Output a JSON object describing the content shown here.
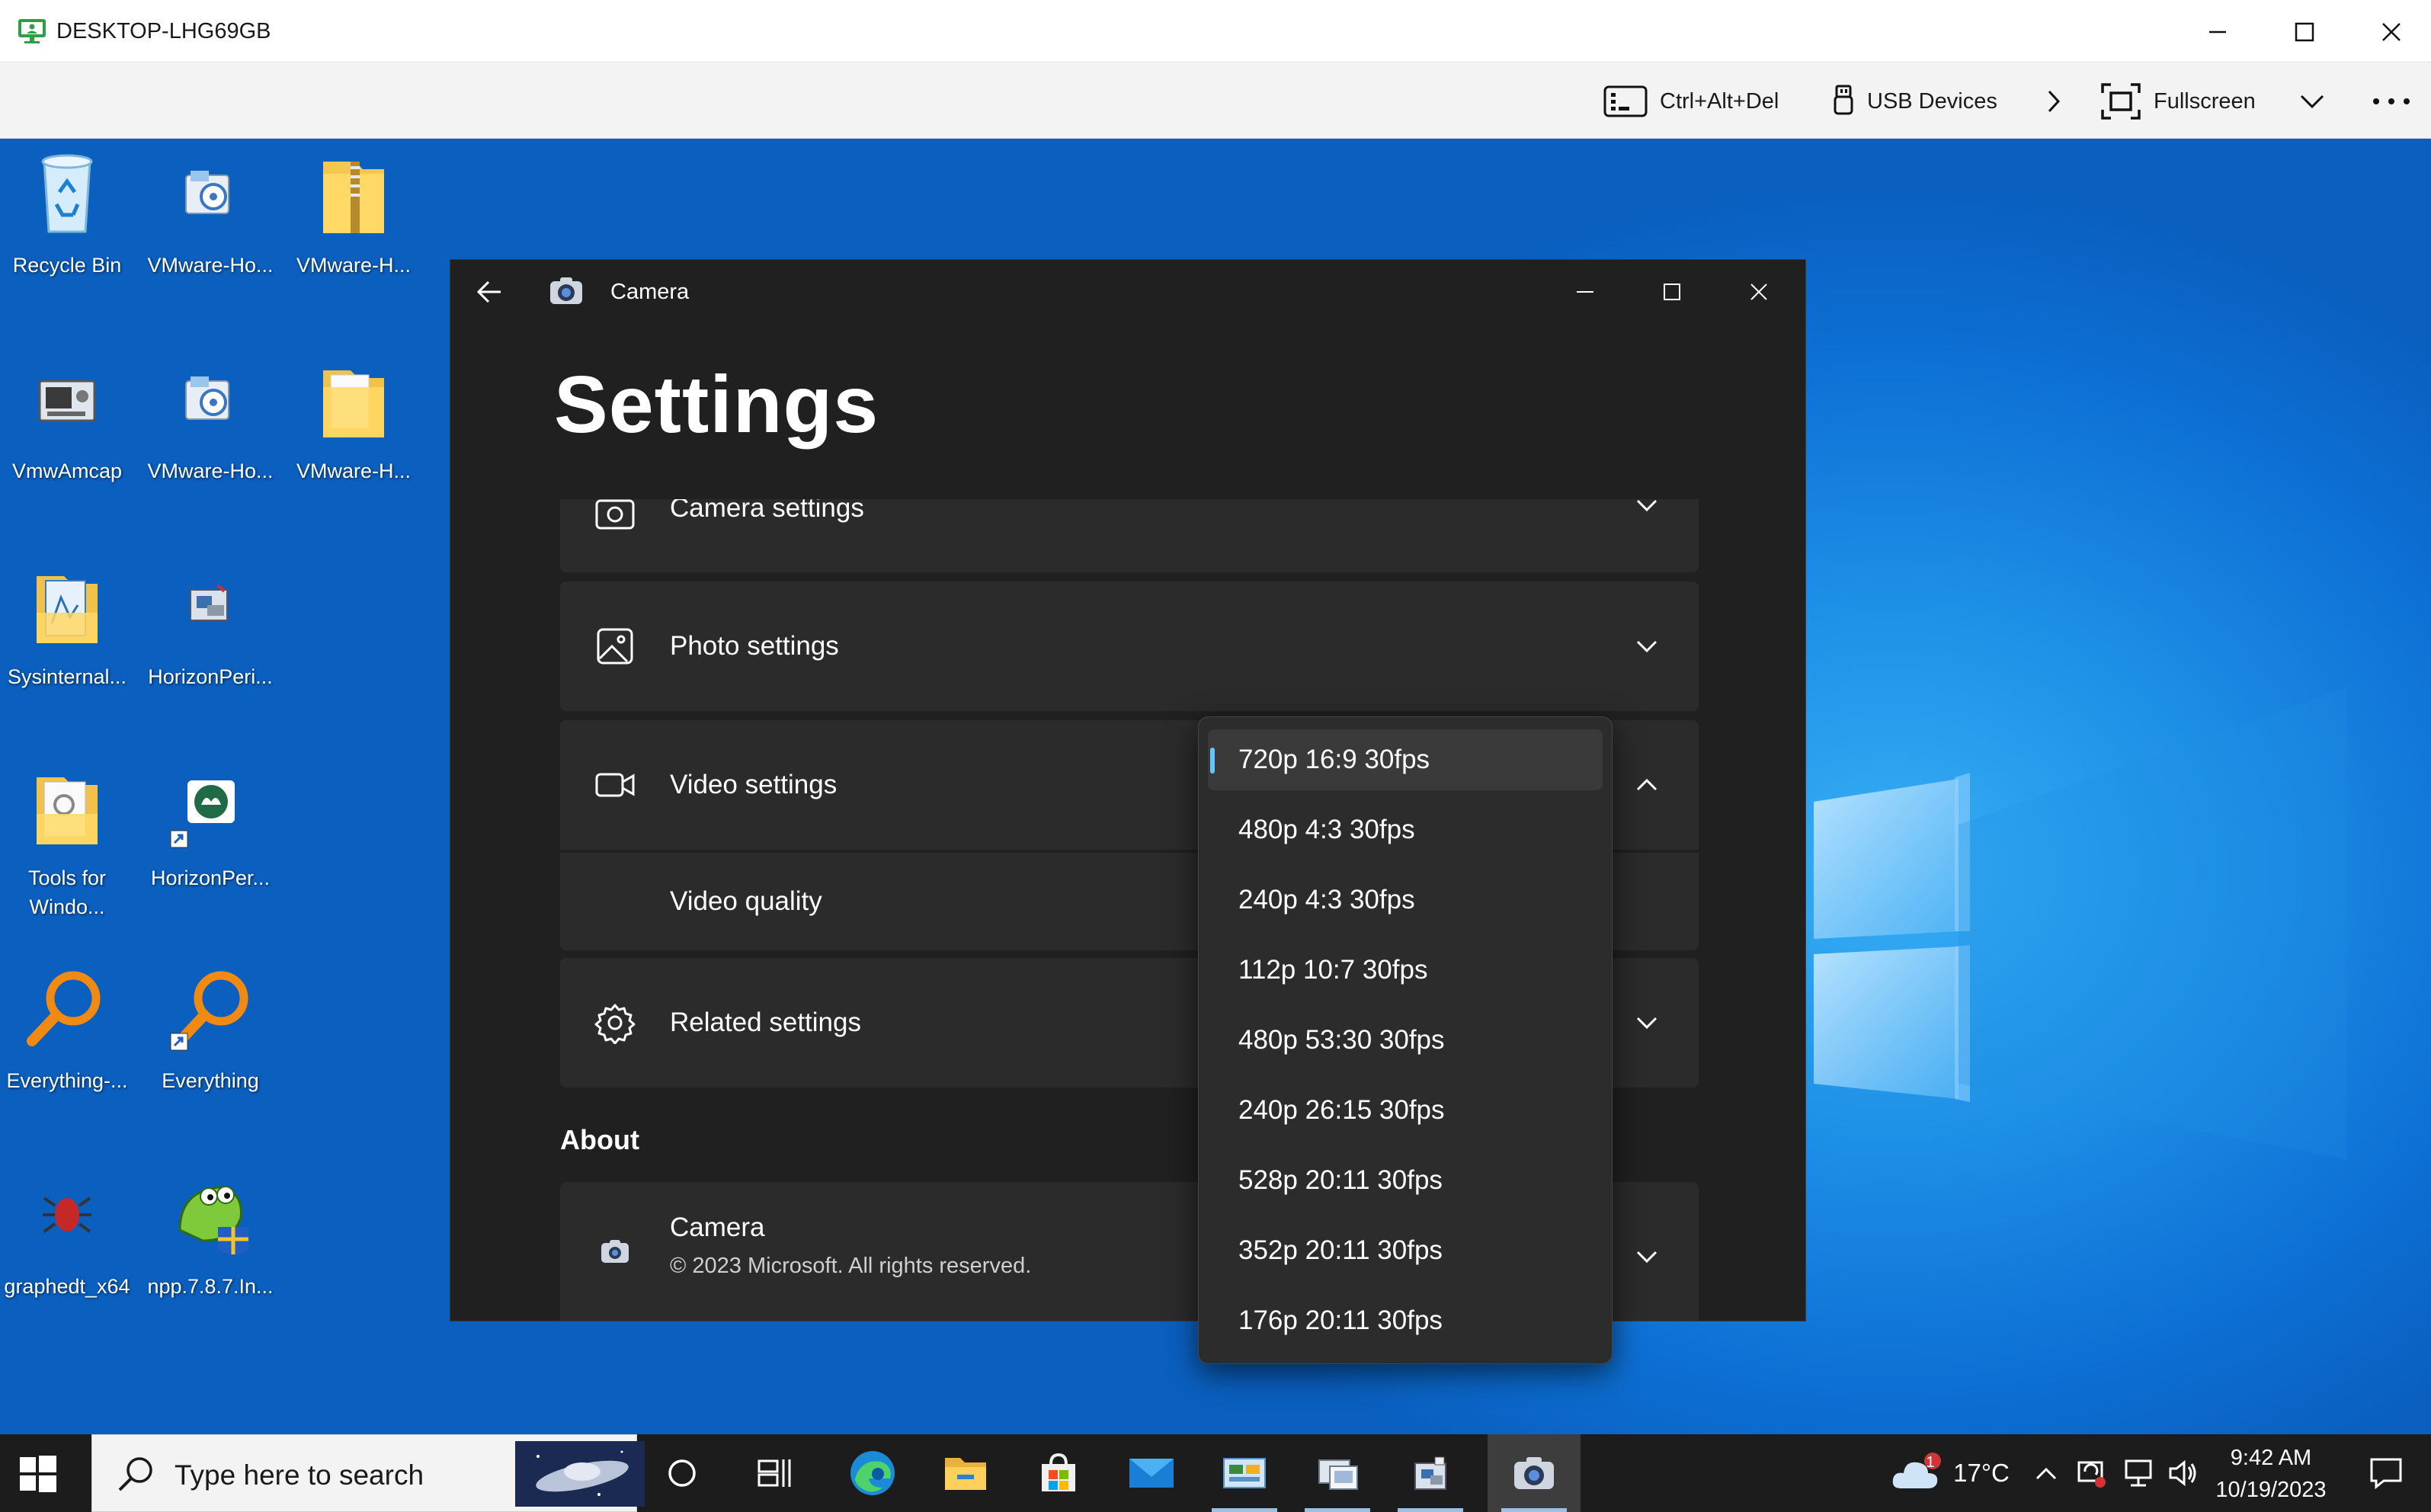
{
  "remote_session": {
    "host_name": "DESKTOP-LHG69GB",
    "toolbar": {
      "ctrl_alt_del": "Ctrl+Alt+Del",
      "usb_devices": "USB Devices",
      "fullscreen": "Fullscreen"
    }
  },
  "desktop": {
    "icons": [
      {
        "label": "Recycle Bin",
        "icon": "recycle-bin-icon"
      },
      {
        "label": "VMware-Ho...",
        "icon": "installer-icon"
      },
      {
        "label": "VMware-H...",
        "icon": "zip-folder-icon"
      },
      {
        "label": "VmwAmcap",
        "icon": "amcap-icon"
      },
      {
        "label": "VMware-Ho...",
        "icon": "installer-icon"
      },
      {
        "label": "VMware-H...",
        "icon": "folder-icon"
      },
      {
        "label": "Sysinternal...",
        "icon": "folder-icon"
      },
      {
        "label": "HorizonPeri...",
        "icon": "app-icon"
      },
      {
        "label": "Tools for Windo...",
        "icon": "folder-icon"
      },
      {
        "label": "HorizonPer...",
        "icon": "shortcut-icon"
      },
      {
        "label": "Everything-...",
        "icon": "magnifier-icon"
      },
      {
        "label": "Everything",
        "icon": "magnifier-icon"
      },
      {
        "label": "graphedt_x64",
        "icon": "graphedit-icon"
      },
      {
        "label": "npp.7.8.7.In...",
        "icon": "notepadpp-icon"
      }
    ]
  },
  "camera_window": {
    "title": "Camera",
    "heading": "Settings",
    "sections": {
      "camera_settings": "Camera settings",
      "photo_settings": "Photo settings",
      "video_settings": "Video settings",
      "video_quality": "Video quality",
      "related_settings": "Related settings"
    },
    "about": {
      "heading": "About",
      "app_name": "Camera",
      "copyright": "© 2023 Microsoft. All rights reserved."
    },
    "video_quality_options": [
      "720p 16:9 30fps",
      "480p 4:3 30fps",
      "240p 4:3 30fps",
      "112p 10:7 30fps",
      "480p 53:30 30fps",
      "240p 26:15 30fps",
      "528p 20:11 30fps",
      "352p 20:11 30fps",
      "176p 20:11 30fps"
    ],
    "selected_option": "720p 16:9 30fps"
  },
  "taskbar": {
    "search_placeholder": "Type here to search",
    "weather_temp": "17°C",
    "weather_badge": "1",
    "time": "9:42 AM",
    "date": "10/19/2023"
  },
  "colors": {
    "accent": "#66c5ff",
    "dark_surface": "#202020",
    "card": "#2b2b2b"
  }
}
